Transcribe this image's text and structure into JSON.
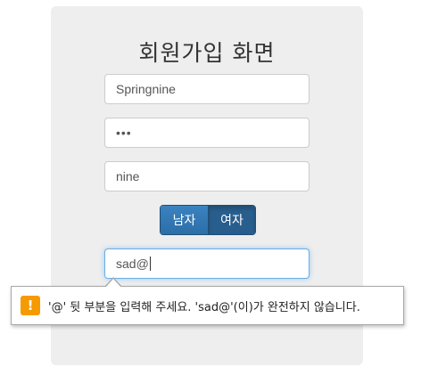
{
  "page": {
    "title": "회원가입 화면"
  },
  "form": {
    "username_value": "Springnine",
    "password_value": "•••",
    "nickname_value": "nine",
    "email_value": "sad@",
    "gender_options": [
      "남자",
      "여자"
    ],
    "gender_selected": "여자"
  },
  "validation_tooltip": {
    "icon": "warning-icon",
    "icon_glyph": "!",
    "message": "'@' 뒷 부분을 입력해 주세요. 'sad@'(이)가 완전하지 않습니다."
  },
  "colors": {
    "panel_bg": "#eeeeee",
    "button_primary": "#337ab7",
    "focus_border": "#66afe9",
    "warning": "#f59a00"
  }
}
